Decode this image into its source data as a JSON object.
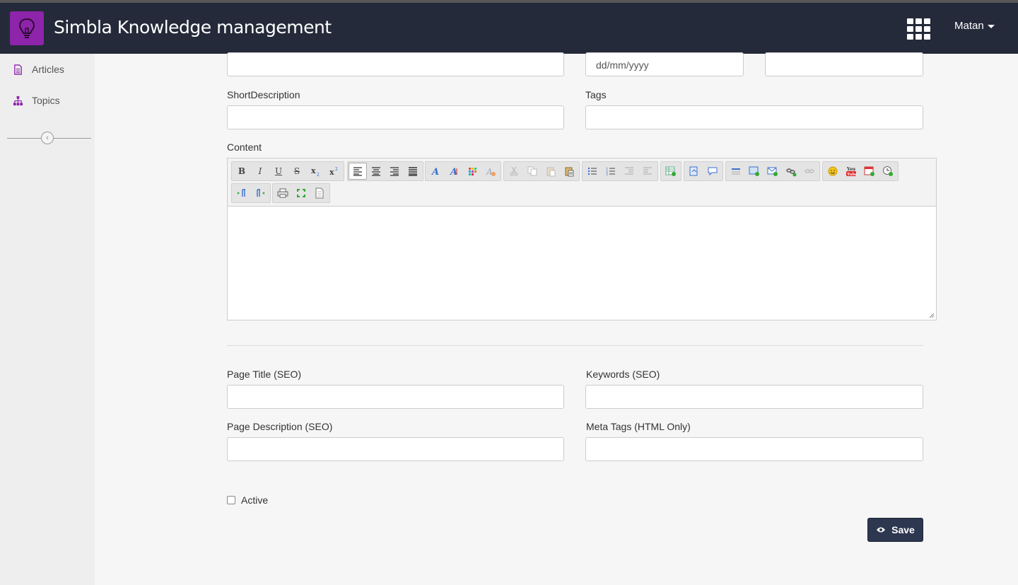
{
  "header": {
    "brand": "Simbla Knowledge management",
    "user": "Matan",
    "brand_color": "#8e24aa",
    "bar_color": "#252a3a"
  },
  "sidebar": {
    "items": [
      {
        "label": "Articles",
        "icon": "document-icon"
      },
      {
        "label": "Topics",
        "icon": "sitemap-icon"
      }
    ],
    "collapse_icon": "chevron-left-icon"
  },
  "form": {
    "date_placeholder": "dd/mm/yyyy",
    "short_description_label": "ShortDescription",
    "tags_label": "Tags",
    "content_label": "Content",
    "page_title_label": "Page Title (SEO)",
    "keywords_label": "Keywords (SEO)",
    "page_description_label": "Page Description (SEO)",
    "meta_tags_label": "Meta Tags (HTML Only)",
    "active_label": "Active",
    "active_checked": false,
    "save_label": "Save",
    "save_color": "#2d3750"
  },
  "editor_toolbar": {
    "bold": "B",
    "italic": "I",
    "underline": "U",
    "strike": "S"
  }
}
